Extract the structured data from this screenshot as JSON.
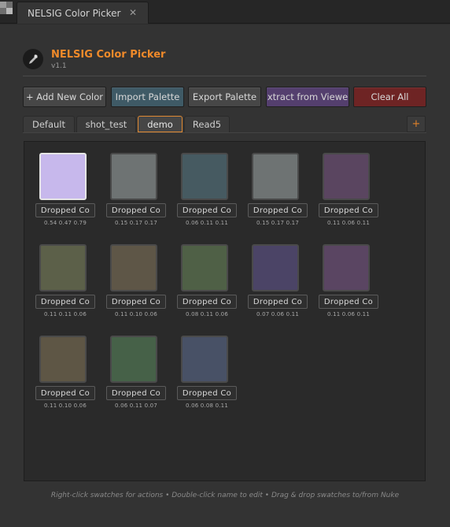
{
  "window_tab": {
    "title": "NELSIG Color Picker",
    "close_glyph": "✕"
  },
  "header": {
    "title": "NELSIG Color Picker",
    "version": "v1.1",
    "logo_icon": "eyedropper-icon"
  },
  "toolbar": {
    "add_label": "+ Add New Color",
    "import_label": "Import Palette",
    "export_label": "Export Palette",
    "extract_label": "xtract from Viewe",
    "clear_label": "Clear All",
    "colors": {
      "add": "#474747",
      "import": "#3f5a66",
      "export": "#474747",
      "extract": "#543f6e",
      "clear": "#6e2424"
    }
  },
  "palette_tabs": [
    {
      "label": "Default",
      "active": false
    },
    {
      "label": "shot_test",
      "active": false
    },
    {
      "label": "demo",
      "active": true
    },
    {
      "label": "Read5",
      "active": false
    }
  ],
  "add_tab_label": "+",
  "accent_color": "#e08a33",
  "swatches": [
    {
      "name": "Dropped Co",
      "values": "0.54 0.47 0.79",
      "color": "#c7b8ec",
      "selected": true
    },
    {
      "name": "Dropped Co",
      "values": "0.15 0.17 0.17",
      "color": "#6e7373",
      "selected": false
    },
    {
      "name": "Dropped Co",
      "values": "0.06 0.11 0.11",
      "color": "#465a61",
      "selected": false
    },
    {
      "name": "Dropped Co",
      "values": "0.15 0.17 0.17",
      "color": "#6e7373",
      "selected": false
    },
    {
      "name": "Dropped Co",
      "values": "0.11 0.06 0.11",
      "color": "#5a4560",
      "selected": false
    },
    {
      "name": "Dropped Co",
      "values": "0.11 0.11 0.06",
      "color": "#5c6049",
      "selected": false
    },
    {
      "name": "Dropped Co",
      "values": "0.11 0.10 0.06",
      "color": "#5e5647",
      "selected": false
    },
    {
      "name": "Dropped Co",
      "values": "0.08 0.11 0.06",
      "color": "#4f6046",
      "selected": false
    },
    {
      "name": "Dropped Co",
      "values": "0.07 0.06 0.11",
      "color": "#4b4466",
      "selected": false
    },
    {
      "name": "Dropped Co",
      "values": "0.11 0.06 0.11",
      "color": "#5a4562",
      "selected": false
    },
    {
      "name": "Dropped Co",
      "values": "0.11 0.10 0.06",
      "color": "#5e5645",
      "selected": false
    },
    {
      "name": "Dropped Co",
      "values": "0.06 0.11 0.07",
      "color": "#466148",
      "selected": false
    },
    {
      "name": "Dropped Co",
      "values": "0.06 0.08 0.11",
      "color": "#485166",
      "selected": false
    }
  ],
  "footer_hint": "Right-click swatches for actions • Double-click name to edit • Drag & drop swatches to/from Nuke"
}
